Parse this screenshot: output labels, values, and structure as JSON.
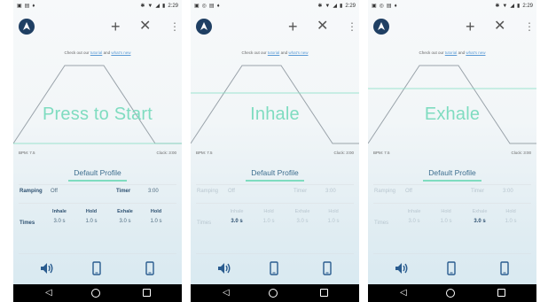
{
  "status_bar": {
    "time": "2:29"
  },
  "app": {
    "tutorial_pre": "Check out our",
    "tutorial_link1": "tutorial",
    "tutorial_mid": "and",
    "tutorial_link2": "what's new",
    "bpm": "BPM: 7.5",
    "clock": "Clock: 3:00",
    "profile": "Default Profile",
    "ramping_label": "Ramping",
    "ramping_value": "Off",
    "timer_label": "Timer",
    "timer_value": "3:00",
    "times_label": "Times",
    "columns": [
      {
        "label": "Inhale",
        "value": "3.0 s"
      },
      {
        "label": "Hold",
        "value": "1.0 s"
      },
      {
        "label": "Exhale",
        "value": "3.0 s"
      },
      {
        "label": "Hold",
        "value": "1.0 s"
      }
    ]
  },
  "screens": [
    {
      "main_text": "Press to Start",
      "threshold_level": 0.0
    },
    {
      "main_text": "Inhale",
      "threshold_level": 0.0
    },
    {
      "main_text": "Exhale",
      "threshold_level": 0.0
    }
  ],
  "colors": {
    "accent": "#7fdcc0",
    "label": "#2f5272",
    "logo": "#1f3f63",
    "navbar": "#000000"
  }
}
